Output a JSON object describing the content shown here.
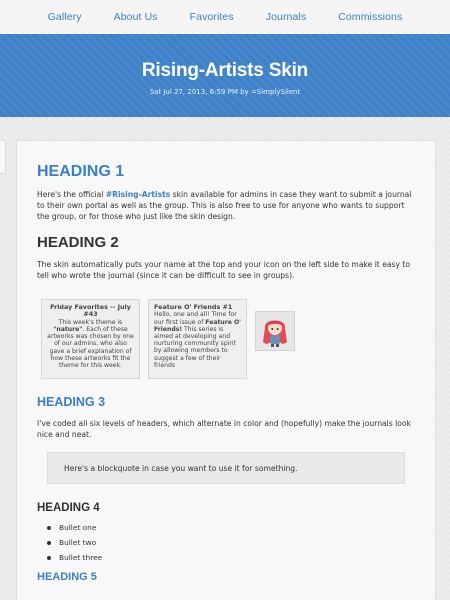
{
  "nav": {
    "items": [
      "Gallery",
      "About Us",
      "Favorites",
      "Journals",
      "Commissions"
    ]
  },
  "header": {
    "title": "Rising-Artists Skin",
    "meta": "Sat Jul 27, 2013, 6:59 PM by =SimplySilent"
  },
  "content": {
    "heading1": "HEADING 1",
    "p1_pre": "Here's the official ",
    "p1_link": "#Rising-Artists",
    "p1_post": " skin available for admins in case they want to submit a journal to their own portal as well as the group. This is also free to use for anyone who wants to support the group, or for those who just like the skin design.",
    "heading2": "HEADING 2",
    "p2": "The skin automatically puts your name at the top and your icon on the left side to make it easy to tell who wrote the journal (since it can be difficult to see in groups).",
    "thumbs": [
      {
        "title": "Friday Favorites -- July #43",
        "body_pre": "This week's theme is ",
        "body_bold": "\"nature\"",
        "body_post": ". Each of these artworks was chosen by one of our admins, who also gave a brief explanation of how these artworks fit the theme for this week."
      },
      {
        "title": "Feature O' Friends #1",
        "body_pre": "Hello, one and all! Time for our first issue of ",
        "body_bold": "Feature O' Friends!",
        "body_post": " This series is aimed at developing and nurturing community spirit by allowing members to suggest a few of their friends"
      }
    ],
    "avatar_icon": "chibi-avatar-icon",
    "heading3": "HEADING 3",
    "p3": "I've coded all six levels of headers, which alternate in color and (hopefully) make the journals look nice and neat.",
    "blockquote": "Here's a blockquote in case you want to use it for something.",
    "heading4": "HEADING 4",
    "bullets": [
      "Bullet one",
      "Bullet two",
      "Bullet three"
    ],
    "heading5": "HEADING 5"
  },
  "colors": {
    "accent": "#3a80c6",
    "banner": "#3f82c9",
    "card_bg": "#f8f8f8"
  }
}
